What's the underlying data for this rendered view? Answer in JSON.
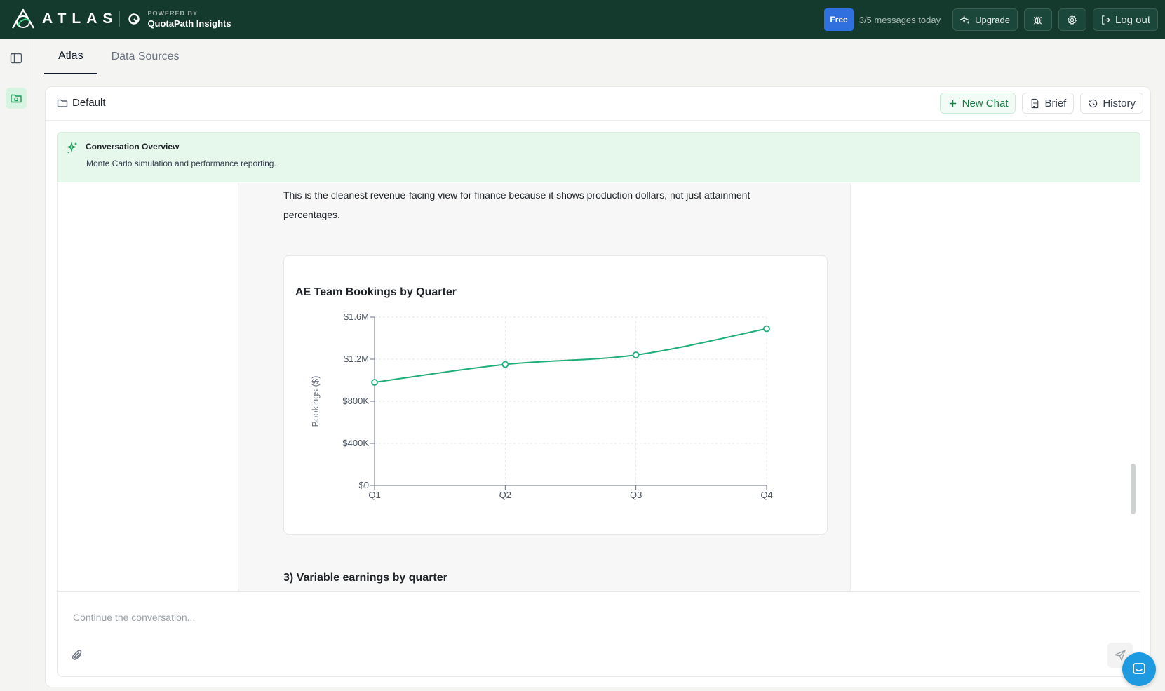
{
  "brand": {
    "name": "ATLAS",
    "powered_by": "POWERED BY",
    "partner": "QuotaPath Insights"
  },
  "topbar": {
    "plan_badge": "Free",
    "message_count": "3/5 messages today",
    "upgrade_label": "Upgrade",
    "logout_label": "Log out",
    "colors": {
      "bg": "#143a2e",
      "badge": "#2f6fde"
    }
  },
  "tabs": [
    {
      "label": "Atlas",
      "active": true
    },
    {
      "label": "Data Sources",
      "active": false
    }
  ],
  "panel": {
    "folder": "Default",
    "actions": {
      "new_chat": "New Chat",
      "brief": "Brief",
      "history": "History"
    }
  },
  "overview": {
    "title": "Conversation Overview",
    "text": "Monte Carlo simulation and performance reporting."
  },
  "message": {
    "paragraph": "This is the cleanest revenue-facing view for finance because it shows production dollars, not just attainment percentages.",
    "next_heading": "3) Variable earnings by quarter"
  },
  "chart_data": {
    "type": "line",
    "title": "AE Team Bookings by Quarter",
    "xlabel": "",
    "ylabel": "Bookings ($)",
    "categories": [
      "Q1",
      "Q2",
      "Q3",
      "Q4"
    ],
    "series": [
      {
        "values": [
          980000,
          1150000,
          1240000,
          1490000
        ],
        "color": "#1fae7a"
      }
    ],
    "ylim": [
      0,
      1600000
    ],
    "yticks": [
      0,
      400000,
      800000,
      1200000,
      1600000
    ],
    "ytick_labels": [
      "$0",
      "$400K",
      "$800K",
      "$1.2M",
      "$1.6M"
    ],
    "grid": true,
    "legend": "none"
  },
  "composer": {
    "placeholder": "Continue the conversation..."
  }
}
